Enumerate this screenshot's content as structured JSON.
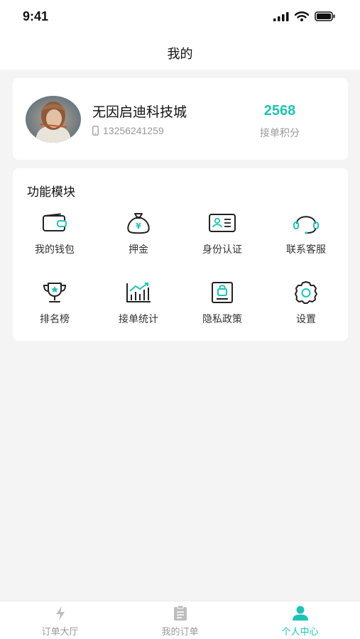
{
  "status_bar": {
    "time": "9:41"
  },
  "nav": {
    "title": "我的"
  },
  "profile": {
    "name": "无因启迪科技城",
    "phone": "13256241259",
    "points_value": "2568",
    "points_label": "接单积分"
  },
  "modules": {
    "title": "功能模块",
    "items": [
      {
        "label": "我的钱包",
        "icon": "wallet-icon"
      },
      {
        "label": "押金",
        "icon": "money-bag-icon"
      },
      {
        "label": "身份认证",
        "icon": "id-card-icon"
      },
      {
        "label": "联系客服",
        "icon": "headset-icon"
      },
      {
        "label": "排名榜",
        "icon": "trophy-icon"
      },
      {
        "label": "接单统计",
        "icon": "chart-icon"
      },
      {
        "label": "隐私政策",
        "icon": "privacy-lock-icon"
      },
      {
        "label": "设置",
        "icon": "gear-icon"
      }
    ]
  },
  "tab_bar": {
    "items": [
      {
        "label": "订单大厅",
        "icon": "lightning-icon"
      },
      {
        "label": "我的订单",
        "icon": "clipboard-icon"
      },
      {
        "label": "个人中心",
        "icon": "person-icon"
      }
    ],
    "active_index": 2
  },
  "colors": {
    "accent": "#21c2b4",
    "text": "#222222",
    "muted": "#999999",
    "background": "#f4f4f4"
  }
}
